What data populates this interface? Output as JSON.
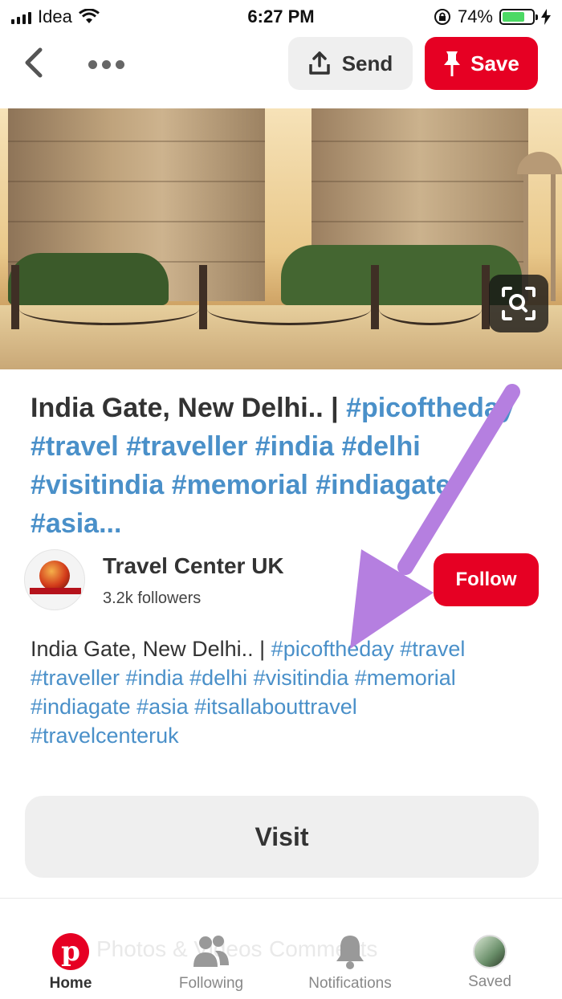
{
  "status_bar": {
    "carrier": "Idea",
    "time": "6:27 PM",
    "battery_percent": "74%",
    "battery_level": 0.74,
    "battery_color": "#4cd964"
  },
  "top_bar": {
    "back_icon": "chevron-left-icon",
    "more_icon": "ellipsis-icon",
    "send_label": "Send",
    "save_label": "Save",
    "accent_color": "#e60023"
  },
  "pin": {
    "title_text": "India Gate, New Delhi.. |",
    "title_tags": "#picoftheday #travel #traveller #india #delhi #visitindia #memorial #indiagate #asia...",
    "visual_search_icon": "visual-search-icon"
  },
  "creator": {
    "name": "Travel Center UK",
    "followers": "3.2k followers",
    "follow_label": "Follow"
  },
  "description": {
    "text": "India Gate, New Delhi.. |",
    "tags": "#picoftheday #travel #traveller #india #delhi #visitindia #memorial #indiagate #asia #itsallabouttravel #travelcenteruk",
    "tag_color": "#4a90c9"
  },
  "visit_label": "Visit",
  "tab_bar": {
    "tabs": [
      {
        "label": "Home",
        "icon": "pinterest-logo-icon",
        "active": true
      },
      {
        "label": "Following",
        "icon": "people-icon",
        "active": false
      },
      {
        "label": "Notifications",
        "icon": "bell-icon",
        "active": false
      },
      {
        "label": "Saved",
        "icon": "profile-avatar",
        "active": false
      }
    ]
  },
  "background_sections": {
    "left": "Photos & Videos",
    "right": "Comments"
  },
  "annotation": {
    "arrow_color": "#b57fe0"
  }
}
